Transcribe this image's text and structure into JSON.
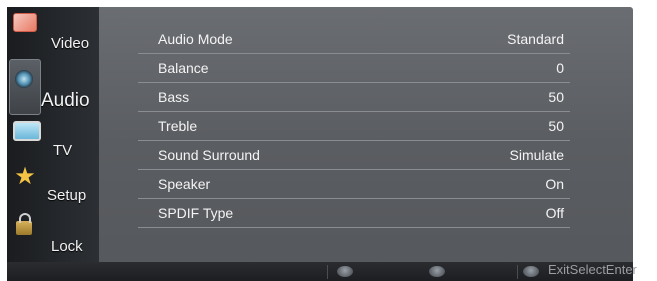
{
  "sidebar": {
    "items": [
      {
        "label": "Video",
        "icon": "video-icon"
      },
      {
        "label": "Audio",
        "icon": "audio-speaker-icon",
        "active": true
      },
      {
        "label": "TV",
        "icon": "tv-icon"
      },
      {
        "label": "Setup",
        "icon": "star-setup-icon"
      },
      {
        "label": "Lock",
        "icon": "padlock-icon"
      }
    ]
  },
  "menu": {
    "rows": [
      {
        "label": "Audio Mode",
        "value": "Standard"
      },
      {
        "label": "Balance",
        "value": "0"
      },
      {
        "label": "Bass",
        "value": "50"
      },
      {
        "label": "Treble",
        "value": "50"
      },
      {
        "label": "Sound Surround",
        "value": "Simulate"
      },
      {
        "label": "Speaker",
        "value": "On"
      },
      {
        "label": "SPDIF Type",
        "value": "Off"
      }
    ]
  },
  "footer": {
    "hint": "ExitSelectEnter"
  },
  "colors": {
    "panel": "#5f6266",
    "sidebar": "#1e2023",
    "text": "#f4f4f4"
  }
}
